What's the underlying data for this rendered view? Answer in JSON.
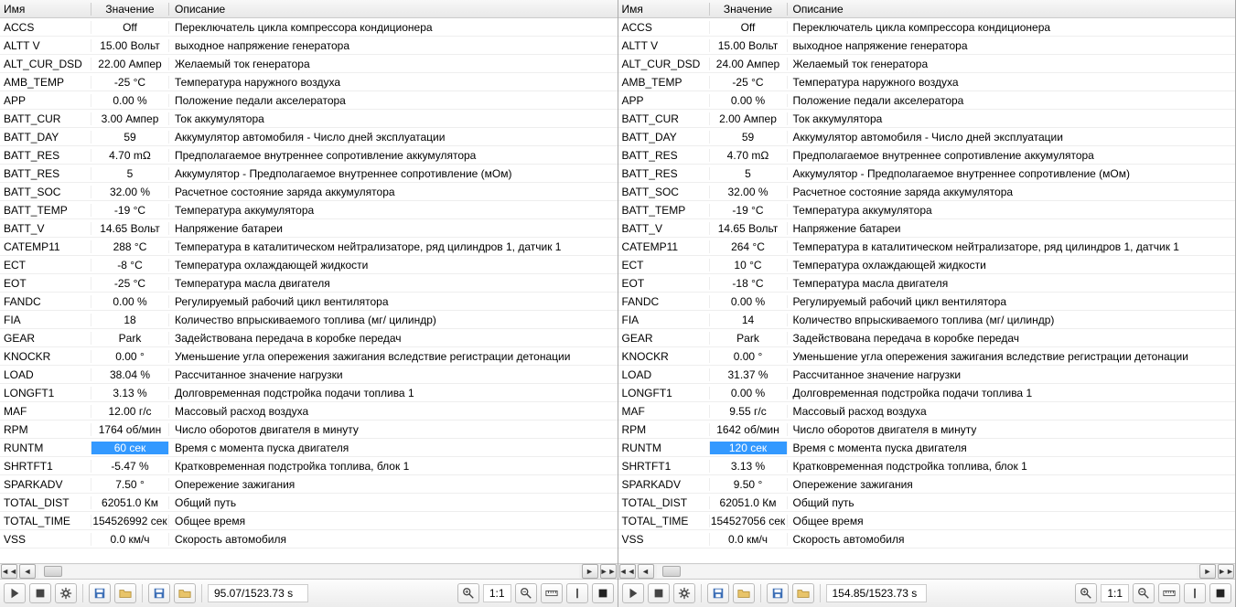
{
  "headers": {
    "name": "Имя",
    "value": "Значение",
    "desc": "Описание"
  },
  "left": {
    "status": "95.07/1523.73 s",
    "ratio": "1:1",
    "rows": [
      {
        "name": "ACCS",
        "value": "Off",
        "desc": "Переключатель цикла компрессора кондиционера"
      },
      {
        "name": "ALTT V",
        "value": "15.00 Вольт",
        "desc": "выходное напряжение генератора"
      },
      {
        "name": "ALT_CUR_DSD",
        "value": "22.00 Ампер",
        "desc": "Желаемый ток генератора"
      },
      {
        "name": "AMB_TEMP",
        "value": "-25 °C",
        "desc": "Температура наружного воздуха"
      },
      {
        "name": "APP",
        "value": "0.00 %",
        "desc": "Положение педали акселератора"
      },
      {
        "name": "BATT_CUR",
        "value": "3.00 Ампер",
        "desc": "Ток аккумулятора"
      },
      {
        "name": "BATT_DAY",
        "value": "59",
        "desc": "Аккумулятор автомобиля - Число дней эксплуатации"
      },
      {
        "name": "BATT_RES",
        "value": "4.70 mΩ",
        "desc": "Предполагаемое внутреннее сопротивление аккумулятора"
      },
      {
        "name": "BATT_RES",
        "value": "5",
        "desc": "Аккумулятор - Предполагаемое внутреннее сопротивление (мОм)"
      },
      {
        "name": "BATT_SOC",
        "value": "32.00 %",
        "desc": "Расчетное состояние заряда аккумулятора"
      },
      {
        "name": "BATT_TEMP",
        "value": "-19 °C",
        "desc": "Температура аккумулятора"
      },
      {
        "name": "BATT_V",
        "value": "14.65 Вольт",
        "desc": "Напряжение батареи"
      },
      {
        "name": "CATEMP11",
        "value": "288 °C",
        "desc": "Температура в каталитическом нейтрализаторе, ряд цилиндров 1, датчик 1"
      },
      {
        "name": "ECT",
        "value": "-8 °C",
        "desc": "Температура охлаждающей жидкости"
      },
      {
        "name": "EOT",
        "value": "-25 °C",
        "desc": "Температура масла двигателя"
      },
      {
        "name": "FANDC",
        "value": "0.00 %",
        "desc": "Регулируемый рабочий цикл вентилятора"
      },
      {
        "name": "FIA",
        "value": "18",
        "desc": "Количество впрыскиваемого топлива (мг/ цилиндр)"
      },
      {
        "name": "GEAR",
        "value": "Park",
        "desc": "Задействована передача в коробке передач"
      },
      {
        "name": "KNOCKR",
        "value": "0.00 °",
        "desc": "Уменьшение угла опережения зажигания вследствие регистрации детонации"
      },
      {
        "name": "LOAD",
        "value": "38.04 %",
        "desc": "Рассчитанное значение нагрузки"
      },
      {
        "name": "LONGFT1",
        "value": "3.13 %",
        "desc": "Долговременная подстройка подачи топлива 1"
      },
      {
        "name": "MAF",
        "value": "12.00 г/с",
        "desc": "Массовый расход воздуха"
      },
      {
        "name": "RPM",
        "value": "1764 об/мин",
        "desc": "Число оборотов двигателя в минуту"
      },
      {
        "name": "RUNTM",
        "value": "60 сек",
        "desc": "Время с момента пуска двигателя",
        "selected": true
      },
      {
        "name": "SHRTFT1",
        "value": "-5.47 %",
        "desc": "Кратковременная подстройка топлива, блок 1"
      },
      {
        "name": "SPARKADV",
        "value": "7.50 °",
        "desc": "Опережение зажигания"
      },
      {
        "name": "TOTAL_DIST",
        "value": "62051.0 Км",
        "desc": "Общий путь"
      },
      {
        "name": "TOTAL_TIME",
        "value": "154526992 сек",
        "desc": "Общее время"
      },
      {
        "name": "VSS",
        "value": "0.0 км/ч",
        "desc": "Скорость автомобиля"
      }
    ]
  },
  "right": {
    "status": "154.85/1523.73 s",
    "ratio": "1:1",
    "rows": [
      {
        "name": "ACCS",
        "value": "Off",
        "desc": "Переключатель цикла компрессора кондиционера"
      },
      {
        "name": "ALTT V",
        "value": "15.00 Вольт",
        "desc": "выходное напряжение генератора"
      },
      {
        "name": "ALT_CUR_DSD",
        "value": "24.00 Ампер",
        "desc": "Желаемый ток генератора"
      },
      {
        "name": "AMB_TEMP",
        "value": "-25 °C",
        "desc": "Температура наружного воздуха"
      },
      {
        "name": "APP",
        "value": "0.00 %",
        "desc": "Положение педали акселератора"
      },
      {
        "name": "BATT_CUR",
        "value": "2.00 Ампер",
        "desc": "Ток аккумулятора"
      },
      {
        "name": "BATT_DAY",
        "value": "59",
        "desc": "Аккумулятор автомобиля - Число дней эксплуатации"
      },
      {
        "name": "BATT_RES",
        "value": "4.70 mΩ",
        "desc": "Предполагаемое внутреннее сопротивление аккумулятора"
      },
      {
        "name": "BATT_RES",
        "value": "5",
        "desc": "Аккумулятор - Предполагаемое внутреннее сопротивление (мОм)"
      },
      {
        "name": "BATT_SOC",
        "value": "32.00 %",
        "desc": "Расчетное состояние заряда аккумулятора"
      },
      {
        "name": "BATT_TEMP",
        "value": "-19 °C",
        "desc": "Температура аккумулятора"
      },
      {
        "name": "BATT_V",
        "value": "14.65 Вольт",
        "desc": "Напряжение батареи"
      },
      {
        "name": "CATEMP11",
        "value": "264 °C",
        "desc": "Температура в каталитическом нейтрализаторе, ряд цилиндров 1, датчик 1"
      },
      {
        "name": "ECT",
        "value": "10 °C",
        "desc": "Температура охлаждающей жидкости"
      },
      {
        "name": "EOT",
        "value": "-18 °C",
        "desc": "Температура масла двигателя"
      },
      {
        "name": "FANDC",
        "value": "0.00 %",
        "desc": "Регулируемый рабочий цикл вентилятора"
      },
      {
        "name": "FIA",
        "value": "14",
        "desc": "Количество впрыскиваемого топлива (мг/ цилиндр)"
      },
      {
        "name": "GEAR",
        "value": "Park",
        "desc": "Задействована передача в коробке передач"
      },
      {
        "name": "KNOCKR",
        "value": "0.00 °",
        "desc": "Уменьшение угла опережения зажигания вследствие регистрации детонации"
      },
      {
        "name": "LOAD",
        "value": "31.37 %",
        "desc": "Рассчитанное значение нагрузки"
      },
      {
        "name": "LONGFT1",
        "value": "0.00 %",
        "desc": "Долговременная подстройка подачи топлива 1"
      },
      {
        "name": "MAF",
        "value": "9.55 г/с",
        "desc": "Массовый расход воздуха"
      },
      {
        "name": "RPM",
        "value": "1642 об/мин",
        "desc": "Число оборотов двигателя в минуту"
      },
      {
        "name": "RUNTM",
        "value": "120 сек",
        "desc": "Время с момента пуска двигателя",
        "selected": true
      },
      {
        "name": "SHRTFT1",
        "value": "3.13 %",
        "desc": "Кратковременная подстройка топлива, блок 1"
      },
      {
        "name": "SPARKADV",
        "value": "9.50 °",
        "desc": "Опережение зажигания"
      },
      {
        "name": "TOTAL_DIST",
        "value": "62051.0 Км",
        "desc": "Общий путь"
      },
      {
        "name": "TOTAL_TIME",
        "value": "154527056 сек",
        "desc": "Общее время"
      },
      {
        "name": "VSS",
        "value": "0.0 км/ч",
        "desc": "Скорость автомобиля"
      }
    ]
  }
}
